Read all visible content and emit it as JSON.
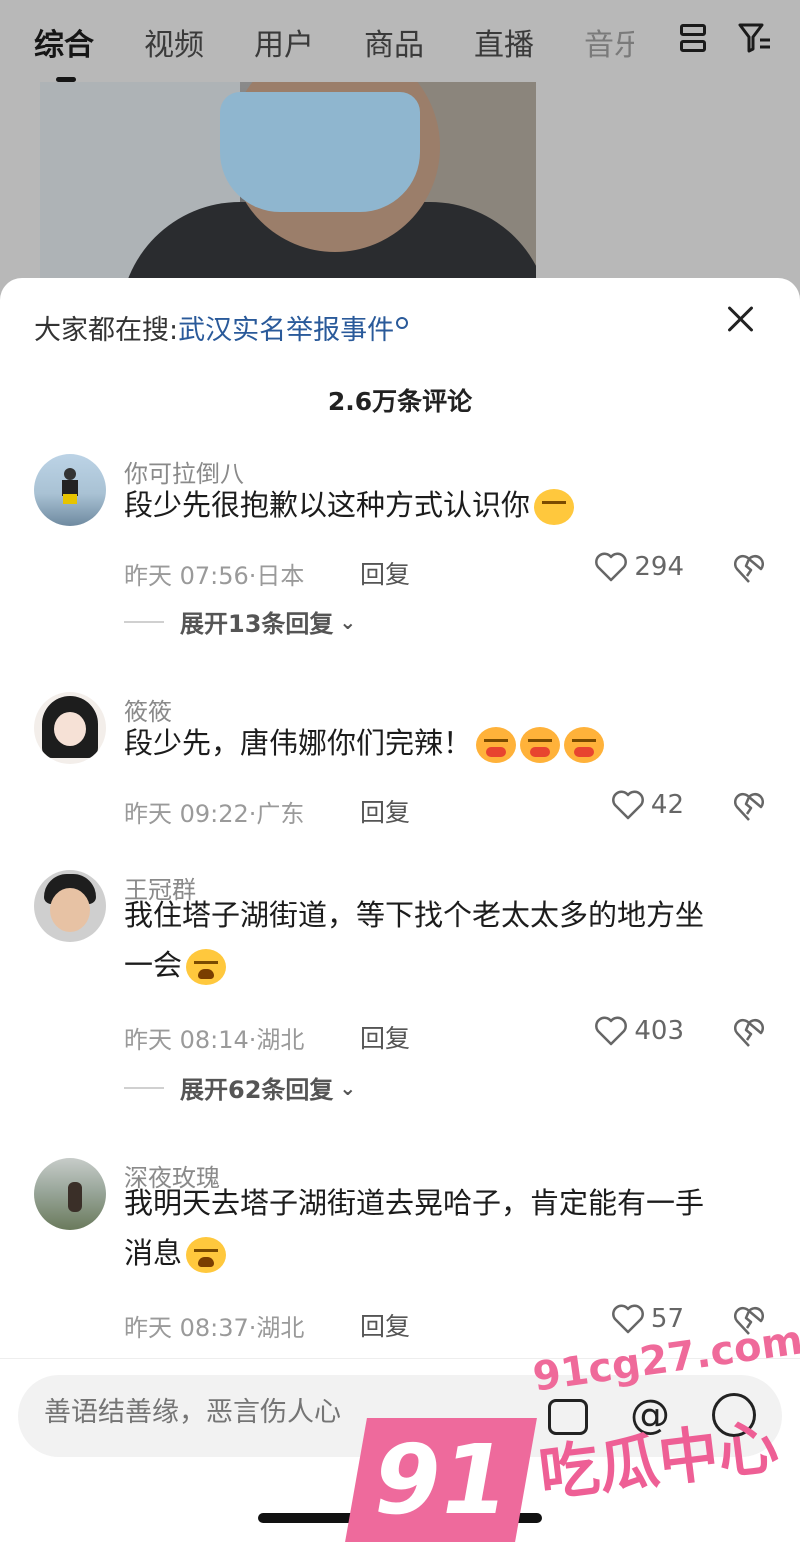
{
  "top_tabs": [
    "综合",
    "视频",
    "用户",
    "商品",
    "直播",
    "音乐"
  ],
  "search_hint": {
    "prefix": "大家都在搜:",
    "query": "武汉实名举报事件"
  },
  "comment_count": "2.6万条评论",
  "comments": [
    {
      "user": "你可拉倒八",
      "text": "段少先很抱歉以这种方式认识你",
      "time": "昨天 07:56·日本",
      "reply": "回复",
      "likes": "294",
      "expand": "展开13条回复"
    },
    {
      "user": "筱筱",
      "text": "段少先，唐伟娜你们完辣！",
      "time": "昨天 09:22·广东",
      "reply": "回复",
      "likes": "42"
    },
    {
      "user": "王冠群",
      "text_line1": "我住塔子湖街道，等下找个老太太多的地方坐",
      "text_line2": "一会",
      "time": "昨天 08:14·湖北",
      "reply": "回复",
      "likes": "403",
      "expand": "展开62条回复"
    },
    {
      "user": "深夜玫瑰",
      "text_line1": "我明天去塔子湖街道去晃哈子，肯定能有一手",
      "text_line2": "消息",
      "time": "昨天 08:37·湖北",
      "reply": "回复",
      "likes": "57"
    }
  ],
  "input": {
    "placeholder": "善语结善缘，恶言伤人心"
  },
  "watermark": {
    "url": "91cg27.com",
    "num": "91",
    "text": "吃瓜中心"
  }
}
